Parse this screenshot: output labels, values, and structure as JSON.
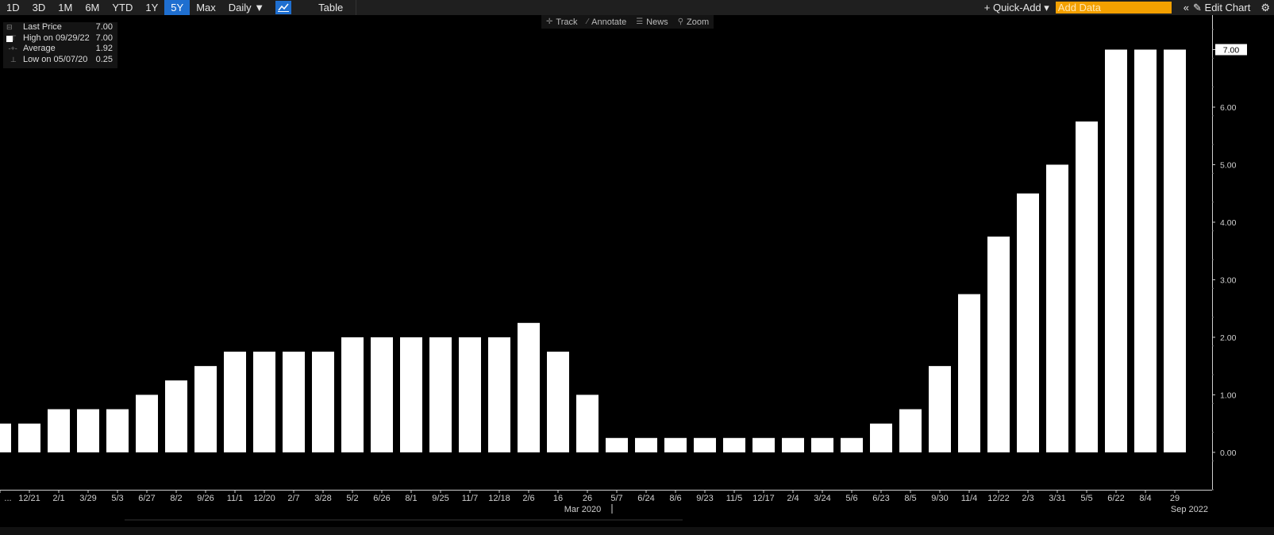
{
  "toolbar": {
    "ranges": [
      "1D",
      "3D",
      "1M",
      "6M",
      "YTD",
      "1Y",
      "5Y",
      "Max"
    ],
    "active_range": "5Y",
    "frequency": "Daily ▼",
    "table_label": "Table",
    "quick_add": "+ Quick-Add ▾",
    "add_data_placeholder": "Add Data",
    "collapse_icon": "double-chevron-left-icon",
    "edit_chart": "✎ Edit Chart",
    "settings_icon": "gear-icon"
  },
  "annotations": {
    "track": "Track",
    "annotate": "Annotate",
    "news": "News",
    "zoom": "Zoom"
  },
  "legend": {
    "last_price_label": "Last Price",
    "last_price_value": "7.00",
    "high_label": "High on 09/29/22",
    "high_value": "7.00",
    "average_label": "Average",
    "average_value": "1.92",
    "low_label": "Low on 05/07/20",
    "low_value": "0.25"
  },
  "chart_data": {
    "type": "bar",
    "categories": [
      "...",
      "12/21",
      "2/1",
      "3/29",
      "5/3",
      "6/27",
      "8/2",
      "9/26",
      "11/1",
      "12/20",
      "2/7",
      "3/28",
      "5/2",
      "6/26",
      "8/1",
      "9/25",
      "11/7",
      "12/18",
      "2/6",
      "16",
      "26",
      "5/7",
      "6/24",
      "8/6",
      "9/23",
      "11/5",
      "12/17",
      "2/4",
      "3/24",
      "5/6",
      "6/23",
      "8/5",
      "9/30",
      "11/4",
      "12/22",
      "2/3",
      "3/31",
      "5/5",
      "6/22",
      "8/4",
      "29"
    ],
    "values": [
      0.5,
      0.5,
      0.75,
      0.75,
      0.75,
      1.0,
      1.25,
      1.5,
      1.75,
      1.75,
      1.75,
      1.75,
      2.0,
      2.0,
      2.0,
      2.0,
      2.0,
      2.0,
      2.25,
      1.75,
      1.0,
      0.25,
      0.25,
      0.25,
      0.25,
      0.25,
      0.25,
      0.25,
      0.25,
      0.25,
      0.5,
      0.75,
      1.5,
      2.75,
      3.75,
      4.5,
      5.0,
      5.75,
      7.0,
      7.0,
      7.0
    ],
    "y_ticks": [
      "0.00",
      "1.00",
      "2.00",
      "3.00",
      "4.00",
      "5.00",
      "6.00",
      "7.00"
    ],
    "ylim": [
      -0.65,
      7.6
    ],
    "last_value_label": "7.00",
    "secondary_labels": [
      "Mar 2020",
      "Sep 2022"
    ],
    "bar_color": "#ffffff",
    "grid": false,
    "legend_position": "top-left"
  }
}
